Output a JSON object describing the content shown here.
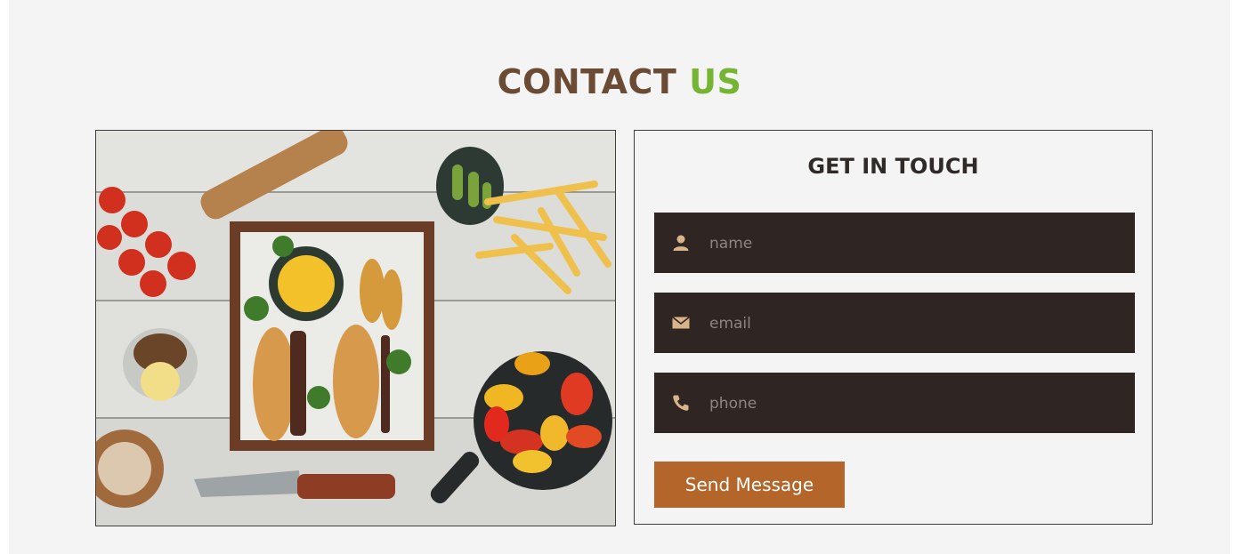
{
  "section": {
    "title_part1": "CONTACT",
    "title_part2": "US"
  },
  "form": {
    "heading": "GET IN TOUCH",
    "name_placeholder": "name",
    "email_placeholder": "email",
    "phone_placeholder": "phone",
    "submit_label": "Send Message"
  },
  "colors": {
    "title_brown": "#6b4b34",
    "title_green": "#75b531",
    "field_bg": "#2f2623",
    "icon_tan": "#d9b48a",
    "button": "#b3652a"
  },
  "icons": {
    "name": "user-icon",
    "email": "envelope-icon",
    "phone": "phone-icon"
  }
}
